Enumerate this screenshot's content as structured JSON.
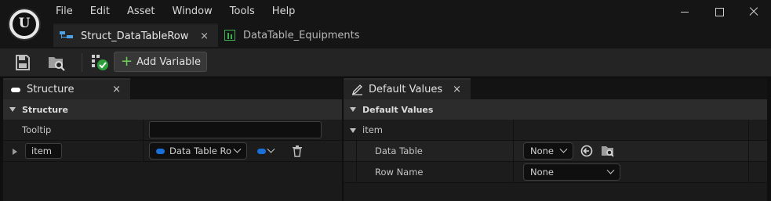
{
  "menu": [
    "File",
    "Edit",
    "Asset",
    "Window",
    "Tools",
    "Help"
  ],
  "doc_tabs": [
    {
      "label": "Struct_DataTableRow",
      "active": true,
      "close": "×"
    },
    {
      "label": "DataTable_Equipments",
      "active": false
    }
  ],
  "toolbar": {
    "add_variable_label": "Add Variable",
    "add_icon": "+"
  },
  "structure_panel": {
    "tab_label": "Structure",
    "close": "×",
    "section_title": "Structure",
    "tooltip_label": "Tooltip",
    "tooltip_value": "",
    "variable_name": "item",
    "variable_type": "Data Table Ro"
  },
  "defaults_panel": {
    "tab_label": "Default Values",
    "close": "×",
    "section_title": "Default Values",
    "group_label": "item",
    "data_table_label": "Data Table",
    "data_table_value": "None",
    "row_name_label": "Row Name",
    "row_name_value": "None"
  },
  "colors": {
    "accent_blue": "#1a6fd9",
    "add_green": "#6fd15a",
    "struct_icon": "#4ea3e6",
    "table_icon": "#3fae4f"
  }
}
